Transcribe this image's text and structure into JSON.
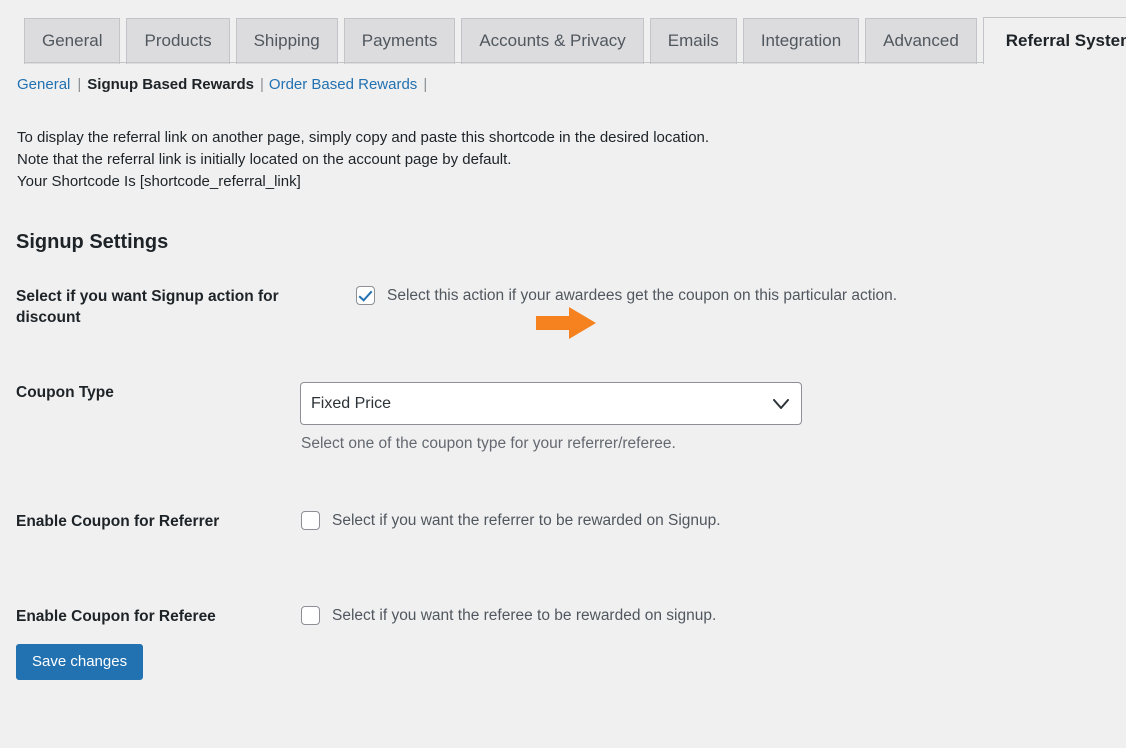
{
  "tabs": [
    {
      "label": "General",
      "active": false
    },
    {
      "label": "Products",
      "active": false
    },
    {
      "label": "Shipping",
      "active": false
    },
    {
      "label": "Payments",
      "active": false
    },
    {
      "label": "Accounts & Privacy",
      "active": false
    },
    {
      "label": "Emails",
      "active": false
    },
    {
      "label": "Integration",
      "active": false
    },
    {
      "label": "Advanced",
      "active": false
    },
    {
      "label": "Referral System",
      "active": true
    }
  ],
  "subnav": {
    "general": "General",
    "signup": "Signup Based Rewards",
    "order": "Order Based Rewards",
    "separator": "|"
  },
  "intro": {
    "line1": "To display the referral link on another page, simply copy and paste this shortcode in the desired location.",
    "line2": "Note that the referral link is initially located on the account page by default.",
    "line3": "Your Shortcode Is [shortcode_referral_link]"
  },
  "section": {
    "title": "Signup Settings"
  },
  "fields": {
    "signup_action": {
      "label": "Select if you want Signup action for discount",
      "checkbox_text": "Select this action if your awardees get the coupon on this particular action.",
      "checked": true
    },
    "coupon_type": {
      "label": "Coupon Type",
      "value": "Fixed Price",
      "help": "Select one of the coupon type for your referrer/referee."
    },
    "enable_referrer": {
      "label": "Enable Coupon for Referrer",
      "checkbox_text": "Select if you want the referrer to be rewarded on Signup.",
      "checked": false
    },
    "enable_referee": {
      "label": "Enable Coupon for Referee",
      "checkbox_text": "Select if you want the referee to be rewarded on signup.",
      "checked": false
    }
  },
  "actions": {
    "save": "Save changes"
  },
  "annotation": {
    "arrow_color": "#F5821F",
    "points_to": "signup-action-checkbox"
  },
  "colors": {
    "page_background": "#f0f0f1",
    "tab_inactive": "#dcdcde",
    "tab_active": "#f0f0f1",
    "link": "#2271b1",
    "primary_button": "#2271b1",
    "checkmark": "#2271b1",
    "border": "#c3c4c7",
    "muted_text": "#646970"
  }
}
